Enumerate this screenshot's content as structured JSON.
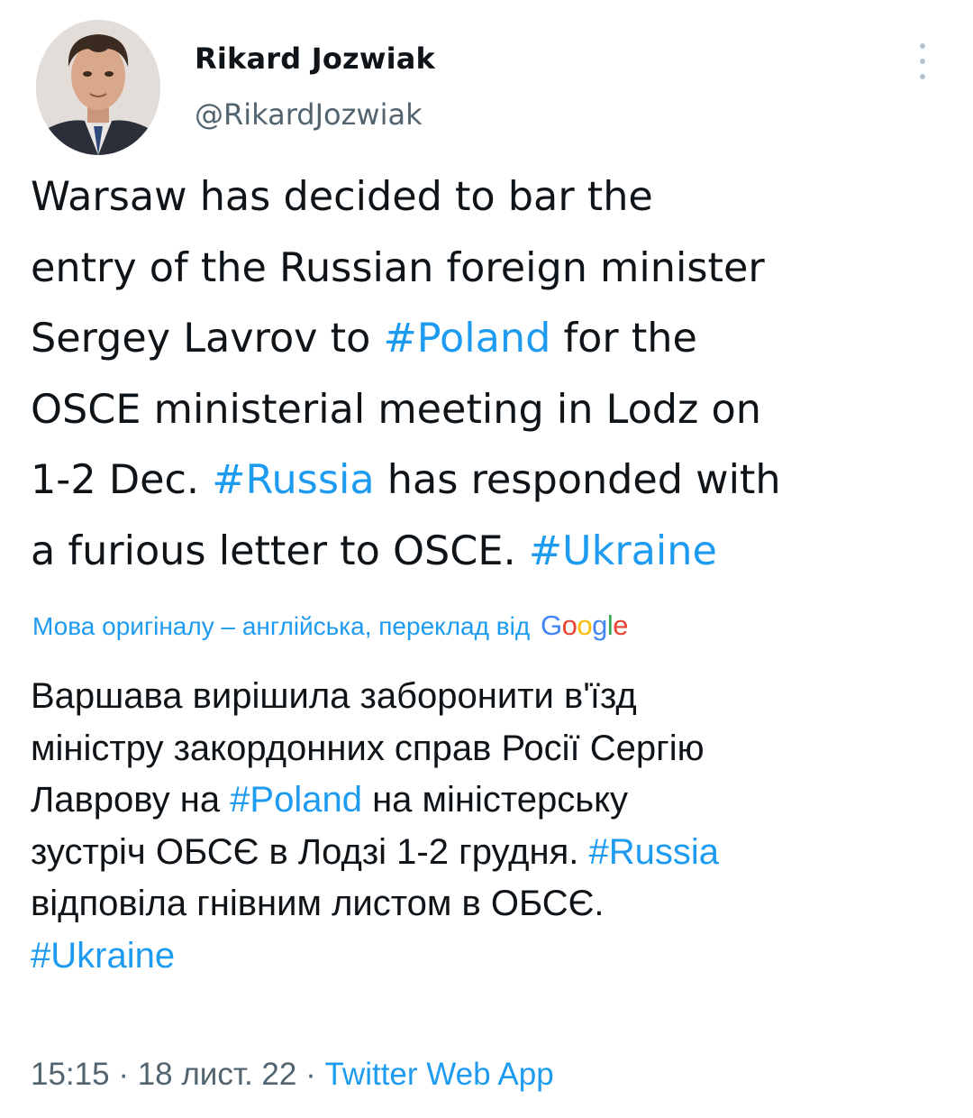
{
  "author": {
    "name": "Rikard Jozwiak",
    "handle": "@RikardJozwiak"
  },
  "tweet": {
    "lines": [
      [
        {
          "t": "Warsaw has decided to bar the"
        }
      ],
      [
        {
          "t": "entry of the Russian foreign minister"
        }
      ],
      [
        {
          "t": "Sergey Lavrov to "
        },
        {
          "t": "#Poland",
          "tag": true
        },
        {
          "t": " for the"
        }
      ],
      [
        {
          "t": "OSCE ministerial meeting in Lodz on"
        }
      ],
      [
        {
          "t": "1-2 Dec. "
        },
        {
          "t": "#Russia",
          "tag": true
        },
        {
          "t": " has responded with"
        }
      ],
      [
        {
          "t": "a furious letter to OSCE. "
        },
        {
          "t": "#Ukraine",
          "tag": true
        }
      ]
    ]
  },
  "translation_note": {
    "text": "Мова оригіналу – англійська, переклад від",
    "provider": "Google"
  },
  "translation": {
    "lines": [
      [
        {
          "t": "Варшава вирішила заборонити в'їзд"
        }
      ],
      [
        {
          "t": "міністру закордонних справ Росії Сергію"
        }
      ],
      [
        {
          "t": "Лаврову на "
        },
        {
          "t": "#Poland",
          "tag": true
        },
        {
          "t": " на міністерську"
        }
      ],
      [
        {
          "t": "зустріч ОБСЄ в Лодзі 1-2 грудня. "
        },
        {
          "t": "#Russia",
          "tag": true
        }
      ],
      [
        {
          "t": "відповіла гнівним листом в ОБСЄ."
        }
      ],
      [
        {
          "t": "#Ukraine",
          "tag": true
        }
      ]
    ]
  },
  "meta": {
    "time": "15:15",
    "separator": " · ",
    "date": "18 лист. 22",
    "source": "Twitter Web App"
  },
  "colors": {
    "link": "#1d9bf0",
    "text": "#0f1419",
    "secondary": "#536471"
  },
  "icons": {
    "more": "more-vertical-icon",
    "avatar": "profile-photo"
  }
}
